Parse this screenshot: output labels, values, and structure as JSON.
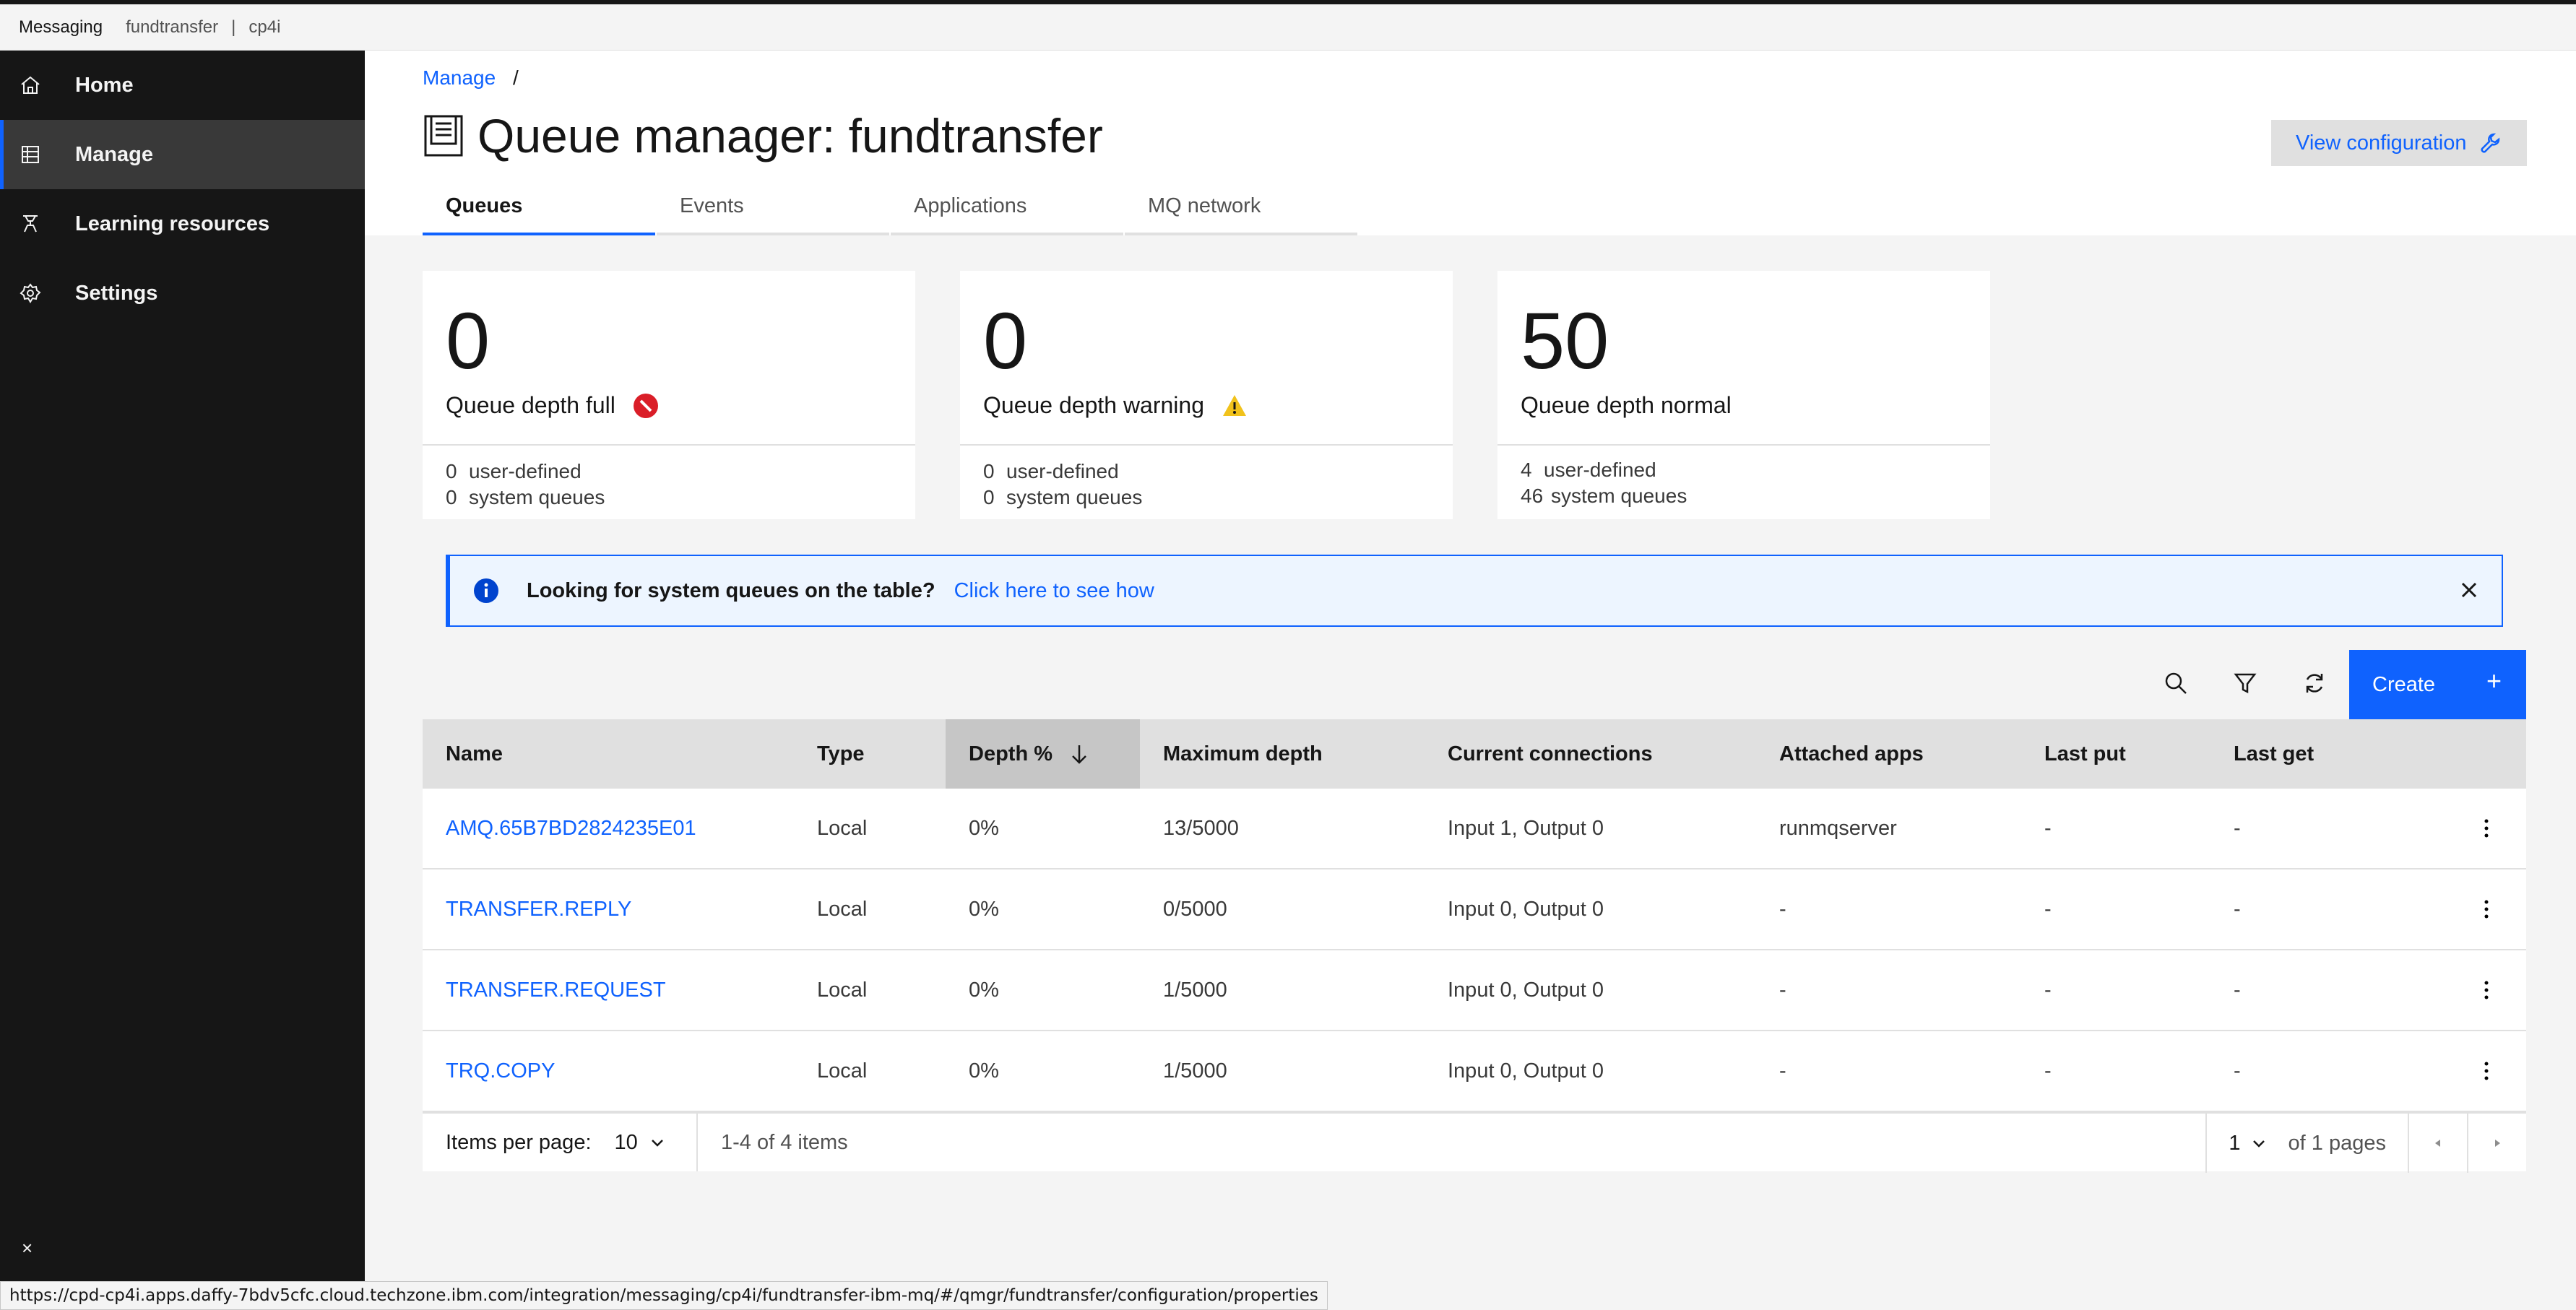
{
  "topbar": {
    "brand": "Messaging",
    "crumb1": "fundtransfer",
    "separator": "|",
    "crumb2": "cp4i"
  },
  "sidebar": {
    "items": [
      {
        "label": "Home",
        "icon": "home-icon"
      },
      {
        "label": "Manage",
        "icon": "grid-icon",
        "active": true
      },
      {
        "label": "Learning resources",
        "icon": "learning-icon"
      },
      {
        "label": "Settings",
        "icon": "gear-icon"
      }
    ],
    "close": "×"
  },
  "breadcrumb": {
    "link": "Manage",
    "slash": "/"
  },
  "page": {
    "title": "Queue manager: fundtransfer",
    "view_config": "View configuration"
  },
  "tabs": [
    "Queues",
    "Events",
    "Applications",
    "MQ network"
  ],
  "cards": [
    {
      "value": "0",
      "label": "Queue depth full",
      "user_n": "0",
      "user_label": "user-defined",
      "sys_n": "0",
      "sys_label": "system queues",
      "status_color": "#da1e28"
    },
    {
      "value": "0",
      "label": "Queue depth warning",
      "user_n": "0",
      "user_label": "user-defined",
      "sys_n": "0",
      "sys_label": "system queues",
      "status_color": "#f1c21b"
    },
    {
      "value": "50",
      "label": "Queue depth normal",
      "user_n": "4",
      "user_label": "user-defined",
      "sys_n": "46",
      "sys_label": "system queues"
    }
  ],
  "notice": {
    "title": "Looking for system queues on the table?",
    "link": "Click here to see how"
  },
  "toolbar": {
    "create": "Create",
    "plus": "+"
  },
  "table": {
    "headers": [
      "Name",
      "Type",
      "Depth %",
      "Maximum depth",
      "Current connections",
      "Attached apps",
      "Last put",
      "Last get"
    ],
    "rows": [
      [
        "AMQ.65B7BD2824235E01",
        "Local",
        "0%",
        "13/5000",
        "Input 1, Output 0",
        "runmqserver",
        "-",
        "-"
      ],
      [
        "TRANSFER.REPLY",
        "Local",
        "0%",
        "0/5000",
        "Input 0, Output 0",
        "-",
        "-",
        "-"
      ],
      [
        "TRANSFER.REQUEST",
        "Local",
        "0%",
        "1/5000",
        "Input 0, Output 0",
        "-",
        "-",
        "-"
      ],
      [
        "TRQ.COPY",
        "Local",
        "0%",
        "1/5000",
        "Input 0, Output 0",
        "-",
        "-",
        "-"
      ]
    ]
  },
  "pagination": {
    "items_per_page_label": "Items per page:",
    "items_per_page": "10",
    "range": "1-4 of 4 items",
    "page": "1",
    "of_pages": "of 1 pages"
  },
  "status_url": "https://cpd-cp4i.apps.daffy-7bdv5cfc.cloud.techzone.ibm.com/integration/messaging/cp4i/fundtransfer-ibm-mq/#/qmgr/fundtransfer/configuration/properties",
  "colors": {
    "accent": "#0f62fe",
    "sidebar": "#161616",
    "error": "#da1e28",
    "warning": "#f1c21b"
  }
}
